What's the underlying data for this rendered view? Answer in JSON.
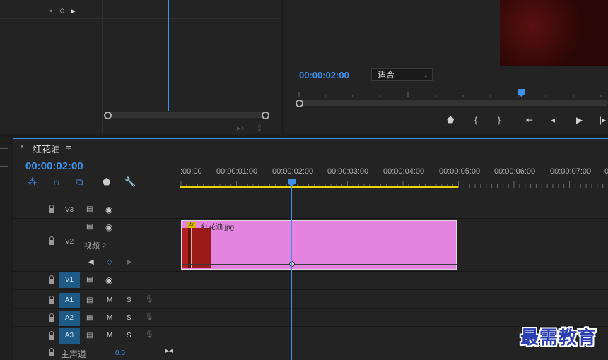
{
  "effect_controls": {
    "nav_prev": "◂",
    "nav_keyframe": "◇",
    "nav_next": "▸"
  },
  "program_monitor": {
    "timecode": "00:00:02:00",
    "fit_label": "适合",
    "buttons": [
      "marker",
      "in",
      "out",
      "go-to-in",
      "step-back",
      "play",
      "step-forward"
    ]
  },
  "timeline": {
    "close": "×",
    "title": "红花油",
    "menu": "≡",
    "timecode": "00:00:02:00",
    "ruler": [
      ":00:00",
      "00:00:01:00",
      "00:00:02:00",
      "00:00:03:00",
      "00:00:04:00",
      "00:00:05:00",
      "00:00:06:00",
      "00:00:07:00",
      "0"
    ],
    "tracks": {
      "v3": "V3",
      "v2": "V2",
      "v2_name": "视频 2",
      "v1": "V1",
      "a1": "A1",
      "a2": "A2",
      "a3": "A3",
      "mute": "M",
      "solo": "S",
      "master": "主声道",
      "master_value": "0.0"
    },
    "clip": {
      "name": "红花油.jpg",
      "fx": "fx"
    }
  },
  "watermark": "最需教育",
  "colors": {
    "accent": "#3f8fe8",
    "clip": "#e484e0",
    "workarea": "#e8d400",
    "track_patch": "#1e5a86"
  }
}
